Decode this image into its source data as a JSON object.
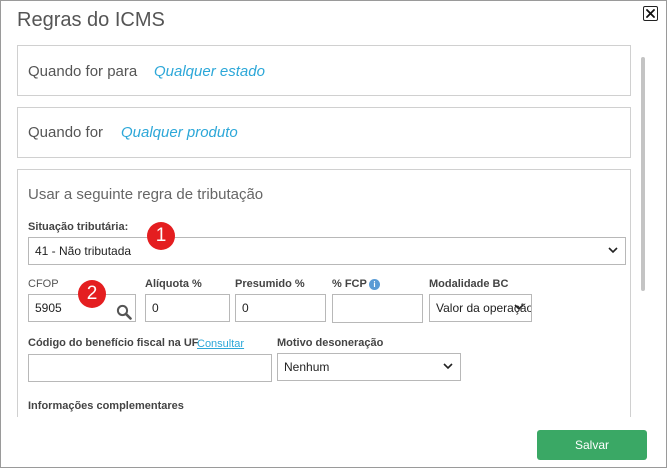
{
  "dialog": {
    "title": "Regras do ICMS",
    "close_icon": "close-icon"
  },
  "rules": {
    "state_label": "Quando for para",
    "state_value": "Qualquer estado",
    "product_label": "Quando for",
    "product_value": "Qualquer produto"
  },
  "taxation": {
    "section_title": "Usar a seguinte regra de tributação",
    "situacao_label": "Situação tributária:",
    "situacao_value": "41 - Não tributada",
    "cfop_label": "CFOP",
    "cfop_value": "5905",
    "aliquota_label": "Alíquota %",
    "aliquota_value": "0",
    "presumido_label": "Presumido %",
    "presumido_value": "0",
    "fcp_label": "% FCP",
    "fcp_value": "",
    "modalidade_label": "Modalidade BC",
    "modalidade_value": "Valor da operação",
    "beneficio_label": "Código do benefício fiscal na UF",
    "beneficio_link": "Consultar",
    "beneficio_value": "",
    "motivo_label": "Motivo desoneração",
    "motivo_value": "Nenhum",
    "info_label": "Informações complementares"
  },
  "annotations": {
    "marker_1": "1",
    "marker_2": "2",
    "color": "#e41e20"
  },
  "footer": {
    "save_label": "Salvar",
    "save_color": "#3aa865"
  },
  "colors": {
    "link": "#2ca7d8",
    "info": "#5a9bd5"
  }
}
